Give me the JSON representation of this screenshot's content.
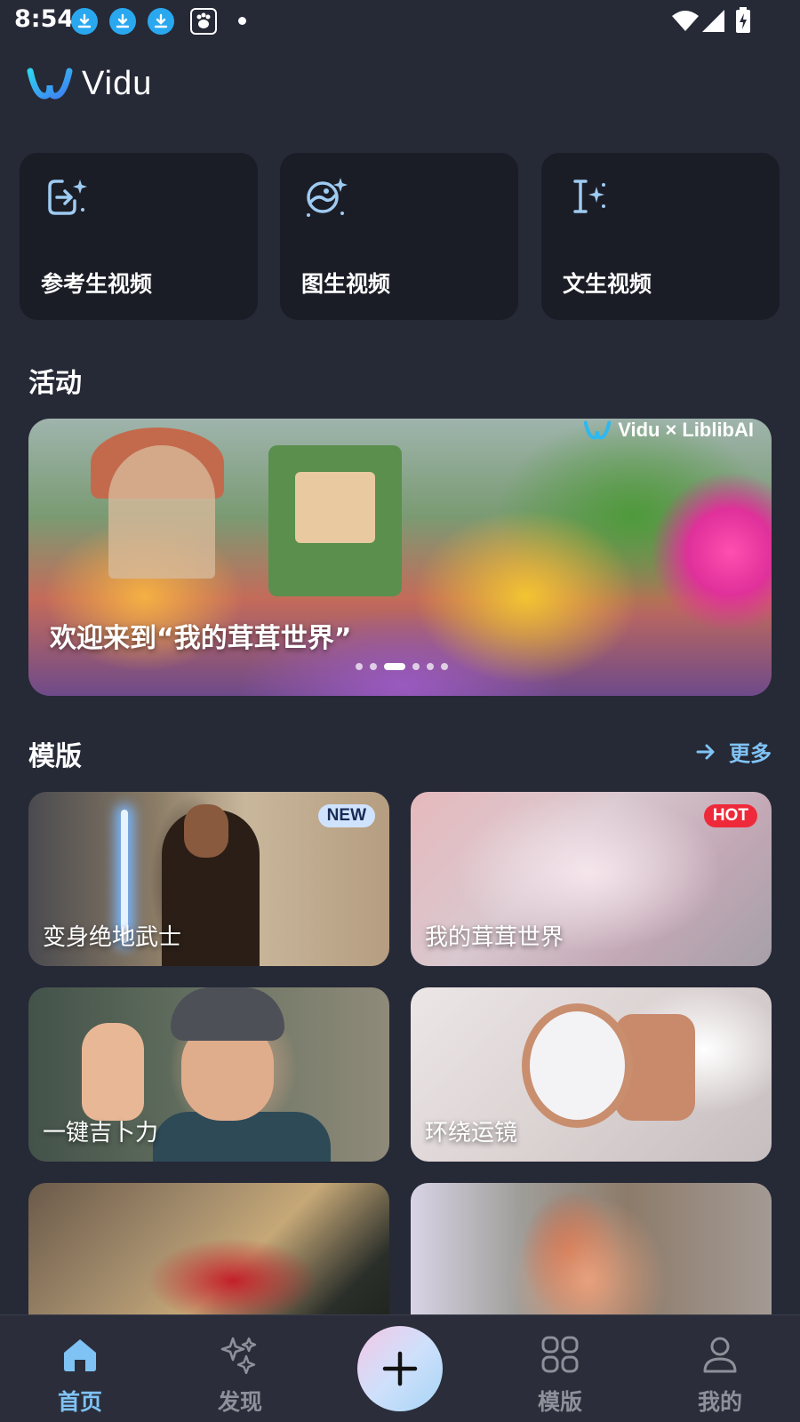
{
  "status_bar": {
    "time": "8:54"
  },
  "app": {
    "logo_text": "Vidu"
  },
  "modes": [
    {
      "label": "参考生视频",
      "icon": "reference-to-video-icon"
    },
    {
      "label": "图生视频",
      "icon": "image-to-video-icon"
    },
    {
      "label": "文生视频",
      "icon": "text-to-video-icon"
    }
  ],
  "activity": {
    "title": "活动",
    "banner": {
      "title": "欢迎来到“我的茸茸世界”",
      "brand_left": "Vidu",
      "brand_sep": "×",
      "brand_right": "LiblibAI",
      "dot_count": 6,
      "active_dot": 2
    }
  },
  "templates": {
    "title": "模版",
    "more_label": "更多",
    "items": [
      {
        "label": "变身绝地武士",
        "badge": "NEW"
      },
      {
        "label": "我的茸茸世界",
        "badge": "HOT"
      },
      {
        "label": "一键吉卜力",
        "badge": ""
      },
      {
        "label": "环绕运镜",
        "badge": ""
      },
      {
        "label": "",
        "badge": ""
      },
      {
        "label": "",
        "badge": ""
      }
    ]
  },
  "bottom_nav": {
    "items": [
      {
        "label": "首页",
        "icon": "home-icon",
        "active": true
      },
      {
        "label": "发现",
        "icon": "sparkle-icon",
        "active": false
      },
      {
        "label": "",
        "icon": "plus-icon",
        "active": false
      },
      {
        "label": "模版",
        "icon": "grid-icon",
        "active": false
      },
      {
        "label": "我的",
        "icon": "user-icon",
        "active": false
      }
    ]
  },
  "colors": {
    "background": "#262936",
    "card": "#1b1d26",
    "accent": "#7fc3f5",
    "hot": "#ee2a3a",
    "new_badge": "#cfe3ff"
  }
}
